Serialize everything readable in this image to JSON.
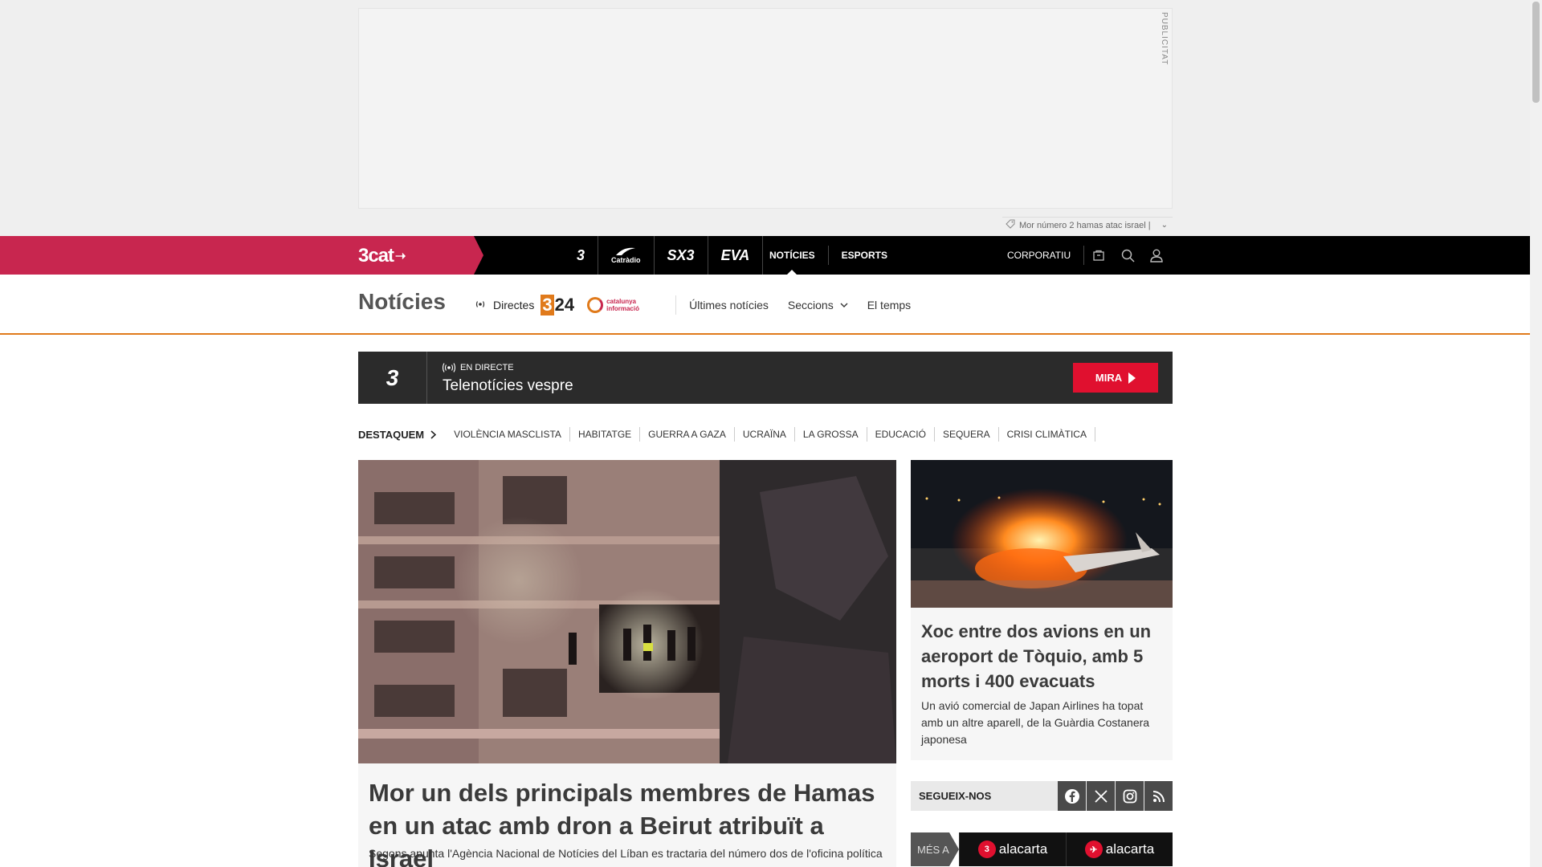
{
  "ad": {
    "label": "PUBLICITAT",
    "tag_text": "Mor número 2 hamas atac israel |"
  },
  "topbar": {
    "brand": "3cat",
    "channels": [
      {
        "name": "tv3-logo",
        "text": "3"
      },
      {
        "name": "catradio-logo",
        "text": "Catràdio"
      },
      {
        "name": "sx3-logo",
        "text": "SX3"
      },
      {
        "name": "eva-logo",
        "text": "EVA"
      }
    ],
    "nav": [
      {
        "label": "NOTÍCIES",
        "active": true
      },
      {
        "label": "ESPORTS",
        "active": false
      }
    ],
    "corporatiu": "CORPORATIU"
  },
  "subhead": {
    "title": "Notícies",
    "directes": "Directes",
    "logo_324": "324",
    "catinfo": "catalunya informació",
    "links": [
      "Últimes notícies",
      "Seccions",
      "El temps"
    ]
  },
  "live": {
    "channel": "3",
    "label": "EN DIRECTE",
    "program": "Telenotícies vespre",
    "button": "MIRA"
  },
  "destaquem": {
    "head": "DESTAQUEM",
    "tags": [
      "VIOLÈNCIA MASCLISTA",
      "HABITATGE",
      "GUERRA A GAZA",
      "UCRAÏNA",
      "LA GROSSA",
      "EDUCACIÓ",
      "SEQUERA",
      "CRISI CLIMÀTICA"
    ]
  },
  "main_story": {
    "headline": "Mor un dels principals membres de Hamas en un atac amb dron a Beirut atribuït a Israel",
    "lead": "Segons apunta l'Agència Nacional de Notícies del Líban es tractaria del número dos de l'oficina política"
  },
  "side_story": {
    "headline": "Xoc entre dos avions en un aeroport de Tòquio, amb 5 morts i 400 evacuats",
    "lead": "Un avió comercial de Japan Airlines ha topat amb un altre aparell, de la Guàrdia Costanera japonesa"
  },
  "follow": {
    "label": "SEGUEIX-NOS",
    "networks": [
      "facebook-icon",
      "x-icon",
      "instagram-icon",
      "rss-icon"
    ]
  },
  "mesa": {
    "label": "MÉS A",
    "items": [
      {
        "badge": "3",
        "text": "alacarta"
      },
      {
        "badge": "✈",
        "text": "alacarta"
      }
    ]
  },
  "colors": {
    "brand": "#c8264f",
    "accent_orange": "#e07a1b",
    "live_button": "#e0102f"
  }
}
